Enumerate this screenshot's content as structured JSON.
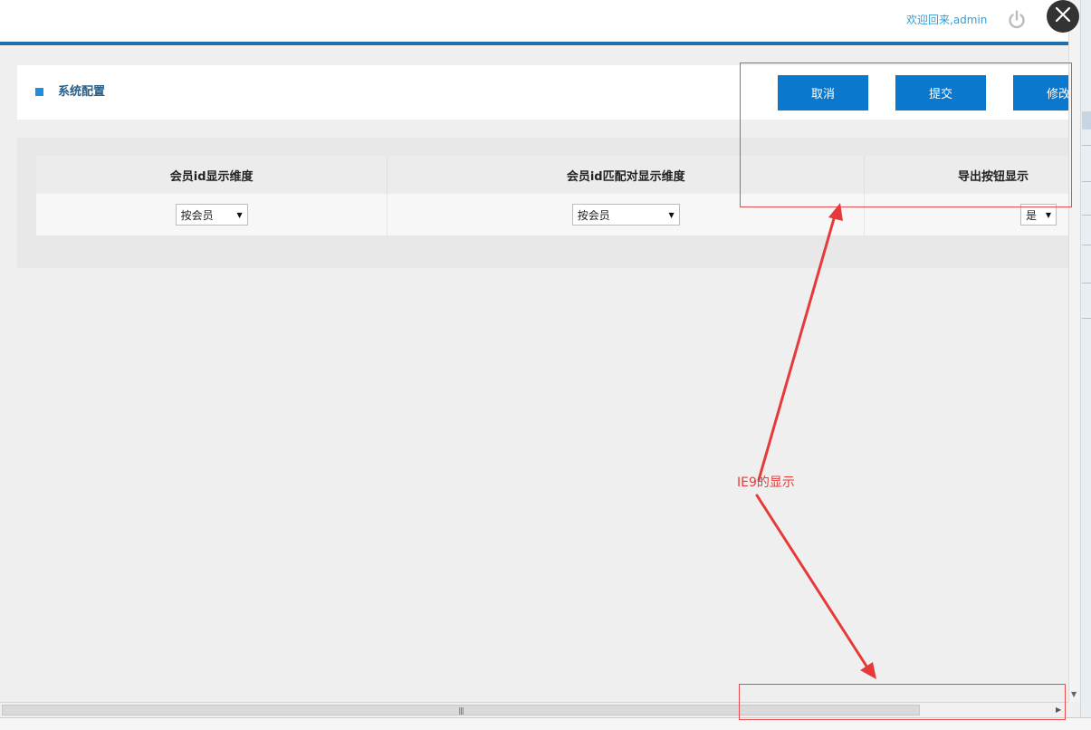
{
  "header": {
    "welcome_text": "欢迎回来,admin"
  },
  "panel": {
    "title": "系统配置",
    "buttons": {
      "cancel": "取消",
      "submit": "提交",
      "edit": "修改"
    }
  },
  "table": {
    "columns": [
      "会员id显示维度",
      "会员id匹配对显示维度",
      "导出按钮显示"
    ],
    "selects": [
      {
        "value": "按会员"
      },
      {
        "value": "按会员"
      },
      {
        "value": "是"
      }
    ]
  },
  "annotation": {
    "text": "IE9的显示",
    "color": "#e83a3a"
  },
  "colors": {
    "accent": "#0a78cc",
    "header_line": "#1d6fb0",
    "title": "#2a5e86"
  },
  "icons": [
    "power-icon",
    "close-icon",
    "square-bullet-icon",
    "dropdown-arrow-icon",
    "scroll-arrow-icon"
  ]
}
